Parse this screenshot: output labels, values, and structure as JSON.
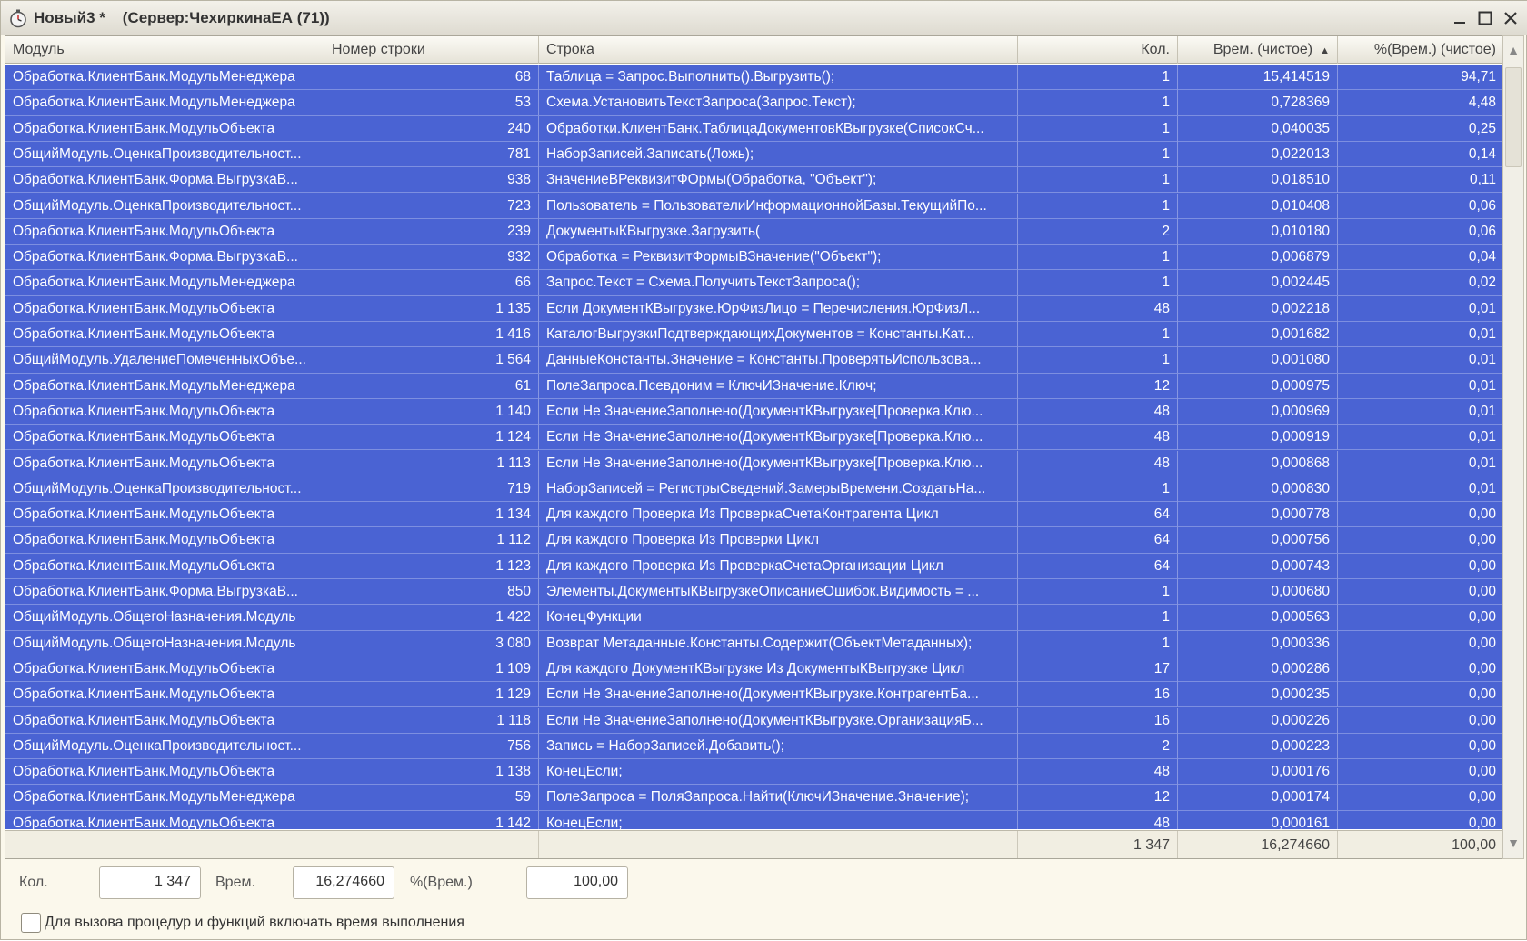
{
  "window": {
    "title": "Новый3 *",
    "server": "(Сервер:ЧехиркинаЕА (71))",
    "minimize_icon": "minimize-icon",
    "maximize_icon": "maximize-icon",
    "close_icon": "close-icon"
  },
  "columns": {
    "module": "Модуль",
    "line_no": "Номер строки",
    "line": "Строка",
    "count": "Кол.",
    "time": "Врем. (чистое)",
    "percent": "%(Врем.) (чистое)"
  },
  "rows": [
    {
      "module": "Обработка.КлиентБанк.МодульМенеджера",
      "line_no": "68",
      "line": "Таблица = Запрос.Выполнить().Выгрузить();",
      "count": "1",
      "time": "15,414519",
      "percent": "94,71"
    },
    {
      "module": "Обработка.КлиентБанк.МодульМенеджера",
      "line_no": "53",
      "line": "Схема.УстановитьТекстЗапроса(Запрос.Текст);",
      "count": "1",
      "time": "0,728369",
      "percent": "4,48"
    },
    {
      "module": "Обработка.КлиентБанк.МодульОбъекта",
      "line_no": "240",
      "line": "Обработки.КлиентБанк.ТаблицаДокументовКВыгрузке(СписокСч...",
      "count": "1",
      "time": "0,040035",
      "percent": "0,25"
    },
    {
      "module": "ОбщийМодуль.ОценкаПроизводительност...",
      "line_no": "781",
      "line": "НаборЗаписей.Записать(Ложь);",
      "count": "1",
      "time": "0,022013",
      "percent": "0,14"
    },
    {
      "module": "Обработка.КлиентБанк.Форма.ВыгрузкаВ...",
      "line_no": "938",
      "line": "ЗначениеВРеквизитФОрмы(Обработка, \"Объект\");",
      "count": "1",
      "time": "0,018510",
      "percent": "0,11"
    },
    {
      "module": "ОбщийМодуль.ОценкаПроизводительност...",
      "line_no": "723",
      "line": "Пользователь = ПользователиИнформационнойБазы.ТекущийПо...",
      "count": "1",
      "time": "0,010408",
      "percent": "0,06"
    },
    {
      "module": "Обработка.КлиентБанк.МодульОбъекта",
      "line_no": "239",
      "line": "ДокументыКВыгрузке.Загрузить(",
      "count": "2",
      "time": "0,010180",
      "percent": "0,06"
    },
    {
      "module": "Обработка.КлиентБанк.Форма.ВыгрузкаВ...",
      "line_no": "932",
      "line": "Обработка = РеквизитФормыВЗначение(\"Объект\");",
      "count": "1",
      "time": "0,006879",
      "percent": "0,04"
    },
    {
      "module": "Обработка.КлиентБанк.МодульМенеджера",
      "line_no": "66",
      "line": "Запрос.Текст = Схема.ПолучитьТекстЗапроса();",
      "count": "1",
      "time": "0,002445",
      "percent": "0,02"
    },
    {
      "module": "Обработка.КлиентБанк.МодульОбъекта",
      "line_no": "1 135",
      "line": "Если ДокументКВыгрузке.ЮрФизЛицо = Перечисления.ЮрФизЛ...",
      "count": "48",
      "time": "0,002218",
      "percent": "0,01"
    },
    {
      "module": "Обработка.КлиентБанк.МодульОбъекта",
      "line_no": "1 416",
      "line": "КаталогВыгрузкиПодтверждающихДокументов = Константы.Кат...",
      "count": "1",
      "time": "0,001682",
      "percent": "0,01"
    },
    {
      "module": "ОбщийМодуль.УдалениеПомеченныхОбъе...",
      "line_no": "1 564",
      "line": "ДанныеКонстанты.Значение = Константы.ПроверятьИспользова...",
      "count": "1",
      "time": "0,001080",
      "percent": "0,01"
    },
    {
      "module": "Обработка.КлиентБанк.МодульМенеджера",
      "line_no": "61",
      "line": "ПолеЗапроса.Псевдоним = КлючИЗначение.Ключ;",
      "count": "12",
      "time": "0,000975",
      "percent": "0,01"
    },
    {
      "module": "Обработка.КлиентБанк.МодульОбъекта",
      "line_no": "1 140",
      "line": "Если Не ЗначениеЗаполнено(ДокументКВыгрузке[Проверка.Клю...",
      "count": "48",
      "time": "0,000969",
      "percent": "0,01"
    },
    {
      "module": "Обработка.КлиентБанк.МодульОбъекта",
      "line_no": "1 124",
      "line": "Если Не ЗначениеЗаполнено(ДокументКВыгрузке[Проверка.Клю...",
      "count": "48",
      "time": "0,000919",
      "percent": "0,01"
    },
    {
      "module": "Обработка.КлиентБанк.МодульОбъекта",
      "line_no": "1 113",
      "line": "Если Не ЗначениеЗаполнено(ДокументКВыгрузке[Проверка.Клю...",
      "count": "48",
      "time": "0,000868",
      "percent": "0,01"
    },
    {
      "module": "ОбщийМодуль.ОценкаПроизводительност...",
      "line_no": "719",
      "line": "НаборЗаписей = РегистрыСведений.ЗамерыВремени.СоздатьНа...",
      "count": "1",
      "time": "0,000830",
      "percent": "0,01"
    },
    {
      "module": "Обработка.КлиентБанк.МодульОбъекта",
      "line_no": "1 134",
      "line": "Для каждого Проверка Из ПроверкаСчетаКонтрагента Цикл",
      "count": "64",
      "time": "0,000778",
      "percent": "0,00"
    },
    {
      "module": "Обработка.КлиентБанк.МодульОбъекта",
      "line_no": "1 112",
      "line": "Для каждого Проверка Из Проверки Цикл",
      "count": "64",
      "time": "0,000756",
      "percent": "0,00"
    },
    {
      "module": "Обработка.КлиентБанк.МодульОбъекта",
      "line_no": "1 123",
      "line": "Для каждого Проверка Из ПроверкаСчетаОрганизации Цикл",
      "count": "64",
      "time": "0,000743",
      "percent": "0,00"
    },
    {
      "module": "Обработка.КлиентБанк.Форма.ВыгрузкаВ...",
      "line_no": "850",
      "line": "Элементы.ДокументыКВыгрузкеОписаниеОшибок.Видимость = ...",
      "count": "1",
      "time": "0,000680",
      "percent": "0,00"
    },
    {
      "module": "ОбщийМодуль.ОбщегоНазначения.Модуль",
      "line_no": "1 422",
      "line": "КонецФункции",
      "count": "1",
      "time": "0,000563",
      "percent": "0,00"
    },
    {
      "module": "ОбщийМодуль.ОбщегоНазначения.Модуль",
      "line_no": "3 080",
      "line": "Возврат Метаданные.Константы.Содержит(ОбъектМетаданных);",
      "count": "1",
      "time": "0,000336",
      "percent": "0,00"
    },
    {
      "module": "Обработка.КлиентБанк.МодульОбъекта",
      "line_no": "1 109",
      "line": "Для каждого ДокументКВыгрузке Из ДокументыКВыгрузке Цикл",
      "count": "17",
      "time": "0,000286",
      "percent": "0,00"
    },
    {
      "module": "Обработка.КлиентБанк.МодульОбъекта",
      "line_no": "1 129",
      "line": "Если Не ЗначениеЗаполнено(ДокументКВыгрузке.КонтрагентБа...",
      "count": "16",
      "time": "0,000235",
      "percent": "0,00"
    },
    {
      "module": "Обработка.КлиентБанк.МодульОбъекта",
      "line_no": "1 118",
      "line": "Если Не ЗначениеЗаполнено(ДокументКВыгрузке.ОрганизацияБ...",
      "count": "16",
      "time": "0,000226",
      "percent": "0,00"
    },
    {
      "module": "ОбщийМодуль.ОценкаПроизводительност...",
      "line_no": "756",
      "line": "Запись = НаборЗаписей.Добавить();",
      "count": "2",
      "time": "0,000223",
      "percent": "0,00"
    },
    {
      "module": "Обработка.КлиентБанк.МодульОбъекта",
      "line_no": "1 138",
      "line": "КонецЕсли;",
      "count": "48",
      "time": "0,000176",
      "percent": "0,00"
    },
    {
      "module": "Обработка.КлиентБанк.МодульМенеджера",
      "line_no": "59",
      "line": "ПолеЗапроса = ПоляЗапроса.Найти(КлючИЗначение.Значение);",
      "count": "12",
      "time": "0,000174",
      "percent": "0,00"
    },
    {
      "module": "Обработка.КлиентБанк.МодульОбъекта",
      "line_no": "1 142",
      "line": "КонецЕсли;",
      "count": "48",
      "time": "0,000161",
      "percent": "0,00"
    }
  ],
  "totals": {
    "count": "1 347",
    "time": "16,274660",
    "percent": "100,00"
  },
  "summary": {
    "count_label": "Кол.",
    "count_value": "1 347",
    "time_label": "Врем.",
    "time_value": "16,274660",
    "percent_label": "%(Врем.)",
    "percent_value": "100,00"
  },
  "checkbox": {
    "label": "Для вызова процедур и функций включать время выполнения",
    "checked": false
  },
  "colors": {
    "selection": "#4a63d3",
    "background": "#fbf8ec"
  }
}
